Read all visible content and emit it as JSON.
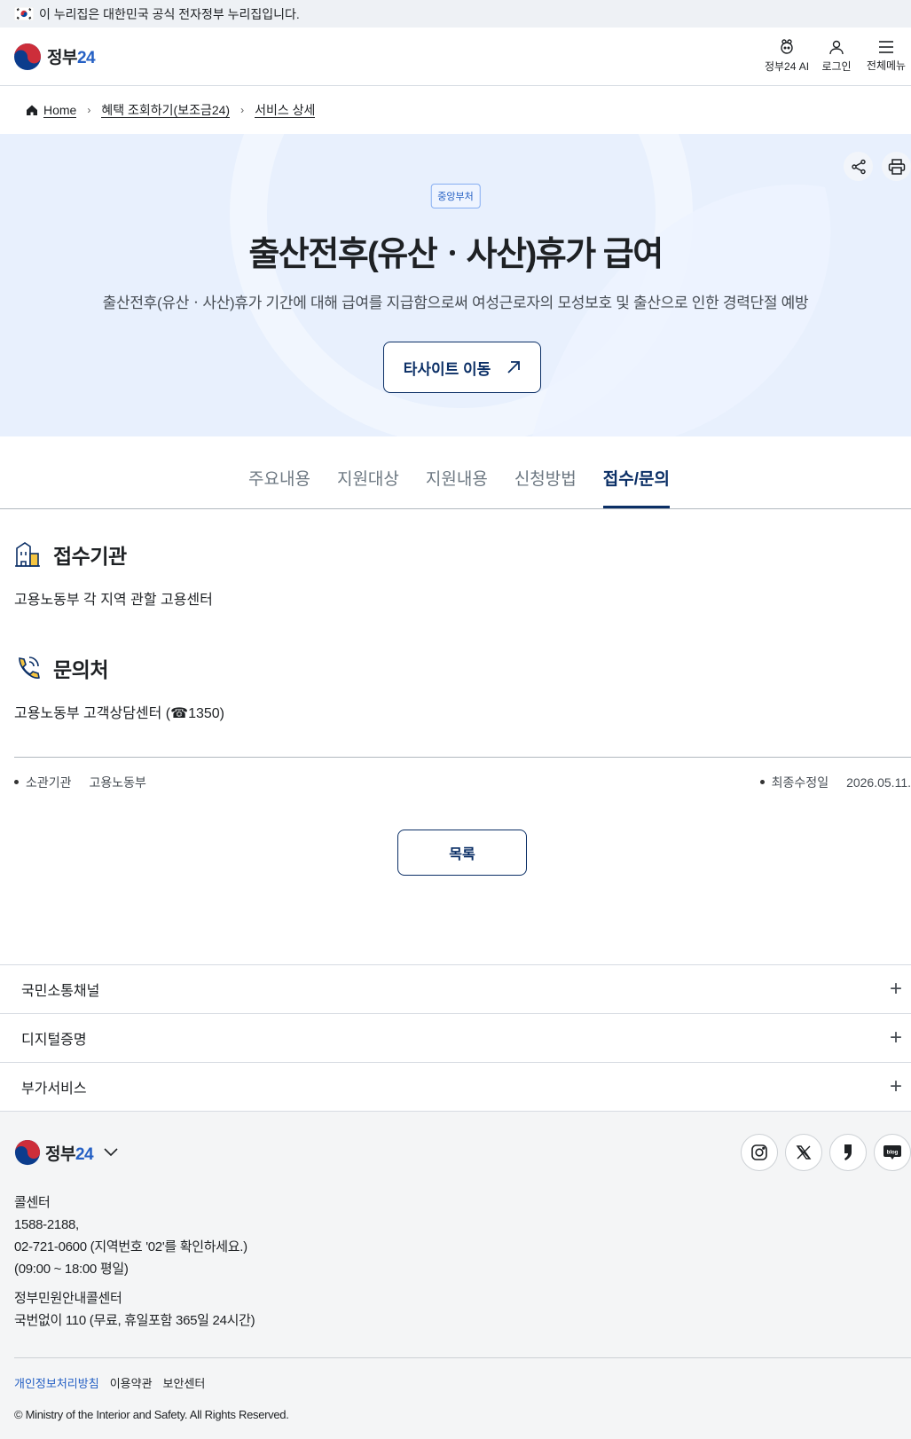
{
  "gov_banner": {
    "text": "이 누리집은 대한민국 공식 전자정부 누리집입니다."
  },
  "header": {
    "logo_text": "정부",
    "logo_num": "24",
    "actions": [
      {
        "label": "정부24 AI",
        "icon": "ai-icon"
      },
      {
        "label": "로그인",
        "icon": "user-icon"
      },
      {
        "label": "전체메뉴",
        "icon": "menu-icon"
      }
    ]
  },
  "breadcrumb": {
    "home": "Home",
    "items": [
      "혜택 조회하기(보조금24)",
      "서비스 상세"
    ]
  },
  "hero": {
    "badge": "중앙부처",
    "title": "출산전후(유산ㆍ사산)휴가 급여",
    "description": "출산전후(유산ㆍ사산)휴가 기간에 대해 급여를 지급함으로써 여성근로자의 모성보호 및 출산으로 인한 경력단절 예방",
    "button_label": "타사이트 이동"
  },
  "tabs": [
    {
      "label": "주요내용",
      "active": false
    },
    {
      "label": "지원대상",
      "active": false
    },
    {
      "label": "지원내용",
      "active": false
    },
    {
      "label": "신청방법",
      "active": false
    },
    {
      "label": "접수/문의",
      "active": true
    }
  ],
  "sections": {
    "reception": {
      "title": "접수기관",
      "body": "고용노동부 각 지역 관할 고용센터"
    },
    "inquiry": {
      "title": "문의처",
      "body": "고용노동부 고객상담센터 (☎1350)"
    }
  },
  "meta": {
    "dept_label": "소관기관",
    "dept_value": "고용노동부",
    "updated_label": "최종수정일",
    "updated_value": "2026.05.11."
  },
  "list_button": "목록",
  "accordion": [
    "국민소통채널",
    "디지털증명",
    "부가서비스"
  ],
  "footer": {
    "logo_text": "정부",
    "logo_num": "24",
    "sns": [
      "instagram-icon",
      "x-icon",
      "naver-post-icon",
      "blog-icon"
    ],
    "info": {
      "line1": "콜센터",
      "line2": "1588-2188,",
      "line3": "02-721-0600 (지역번호 '02'를 확인하세요.)",
      "line4": "(09:00 ~ 18:00 평일)",
      "line5": "정부민원안내콜센터",
      "line6": "국번없이 110 (무료, 휴일포함 365일 24시간)"
    },
    "links": [
      "개인정보처리방침",
      "이용약관",
      "보안센터"
    ],
    "copyright": "© Ministry of the Interior and Safety. All Rights Reserved."
  },
  "colors": {
    "primary": "#0b2f66",
    "accent": "#2560c4",
    "hero_bg": "#e8f0fd"
  }
}
